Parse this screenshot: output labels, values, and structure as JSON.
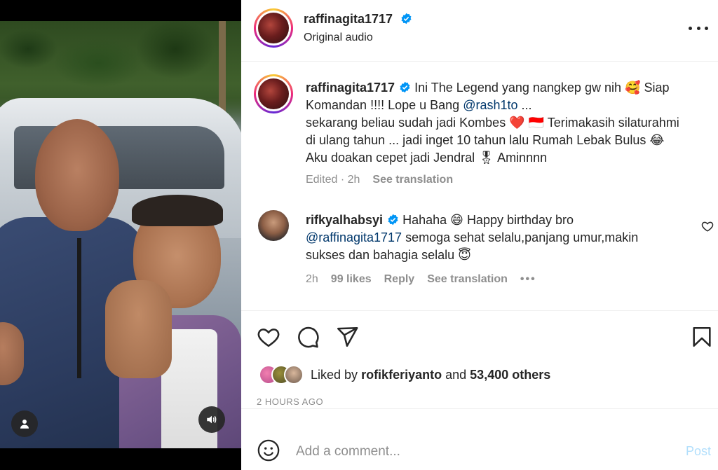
{
  "post": {
    "author": "raffinagita1717",
    "subtitle": "Original audio",
    "icons": {
      "more": "more-horizontal-icon",
      "verified": "verified-badge-icon"
    }
  },
  "media": {
    "buttons": {
      "tag": "person-tag-icon",
      "audio": "speaker-volume-icon"
    }
  },
  "caption": {
    "author": "raffinagita1717",
    "line1_text": "Ini The Legend yang nangkep gw nih",
    "line1_emoji": "🥰",
    "line1_tail": "Siap",
    "line2_text": "Komandan !!!! Lope u Bang",
    "line2_mention": "@rash1to",
    "line2_ellipsis": "...",
    "line3_text": "sekarang beliau sudah jadi Kombes",
    "line3_emoji1": "❤️",
    "line3_emoji2": "🇮🇩",
    "line3_tail": "Terimakasih silaturahmi",
    "line4_text": "di ulang tahun ... jadi inget 10 tahun lalu Rumah Lebak Bulus",
    "line4_emoji": "😂",
    "line5_text": "Aku doakan cepet jadi Jendral",
    "line5_emoji": "🎖",
    "line5_tail": "Aminnnn",
    "edited": "Edited · 2h",
    "see_translation": "See translation"
  },
  "reply": {
    "author": "rifkyalhabsyi",
    "text_a": "Hahaha",
    "emoji_a": "😄",
    "text_b": "Happy birthday bro",
    "mention": "@raffinagita1717",
    "text_c": "semoga sehat selalu,panjang umur,makin",
    "text_d": "sukses dan bahagia selalu",
    "emoji_d": "😇",
    "time": "2h",
    "likes": "99 likes",
    "reply_label": "Reply",
    "see_translation": "See translation"
  },
  "actions": {
    "icons": [
      "heart-icon",
      "comment-icon",
      "share-icon",
      "bookmark-icon"
    ]
  },
  "liked_by": {
    "prefix": "Liked by",
    "user": "rofikferiyanto",
    "and": "and",
    "others": "53,400 others"
  },
  "timestamp": "2 HOURS AGO",
  "composer": {
    "placeholder": "Add a comment...",
    "post_label": "Post"
  },
  "colors": {
    "link": "#00376b",
    "verified": "#0095f6",
    "post_disabled": "#b2dffc",
    "muted": "#8e8e8e"
  }
}
